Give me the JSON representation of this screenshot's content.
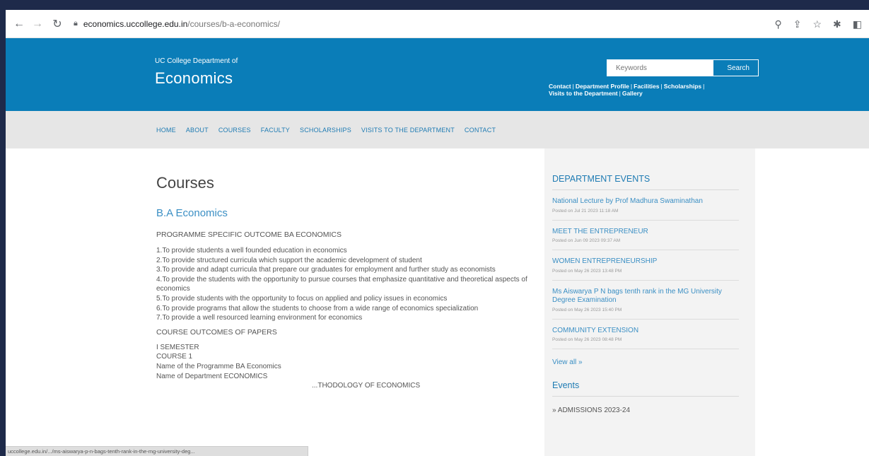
{
  "browser": {
    "url_host": "economics.ucc​ollege.edu.in",
    "url_path": "/courses/b-a-economics/",
    "status_url": "ucc​ollege.edu.in/.../ms-aiswarya-p-n-bags-tenth-rank-in-the-mg-university-deg..."
  },
  "header": {
    "brand_small": "UC College Department of",
    "brand_big": "Economics",
    "search_placeholder": "Keywords",
    "search_button": "Search",
    "quick_links": [
      "Contact",
      "Department Profile",
      "Facilities",
      "Scholarships",
      "Visits to the Department",
      "Gallery"
    ]
  },
  "nav": {
    "items": [
      "HOME",
      "ABOUT",
      "COURSES",
      "FACULTY",
      "SCHOLARSHIPS",
      "VISITS TO THE DEPARTMENT",
      "CONTACT"
    ]
  },
  "main": {
    "page_title": "Courses",
    "course_title": "B.A Economics",
    "programme_heading": "PROGRAMME SPECIFIC OUTCOME BA ECONOMICS",
    "outcomes": [
      "1.To provide students a well founded education in economics",
      "2.To provide structured curricula which support the academic development of student",
      "3.To provide and adapt curricula that prepare our graduates for employment and further study as economists",
      "4.To provide the students with the opportunity to pursue courses that emphasize quantitative and theoretical aspects of economics",
      "5.To provide students with the opportunity to focus on applied and policy issues in economics",
      "6.To provide programs that allow the students to choose from a wide range of economics specialization",
      "7.To provide a well resourced learning environment for economics"
    ],
    "course_outcomes_heading": "COURSE OUTCOMES OF PAPERS",
    "semester": "I SEMESTER",
    "course": "COURSE 1",
    "programme_name": "Name of the Programme BA Economics",
    "department_name": "Name of Department ECONOMICS",
    "hidden_line": "...THODOLOGY OF ECONOMICS"
  },
  "sidebar": {
    "events_title": "DEPARTMENT EVENTS",
    "events": [
      {
        "title": "National Lecture by Prof Madhura Swaminathan",
        "date": "Posted on Jul 21 2023 11:18 AM"
      },
      {
        "title": "MEET THE ENTREPRENEUR",
        "date": "Posted on Jun 09 2023 09:37 AM"
      },
      {
        "title": "WOMEN ENTREPRENEURSHIP",
        "date": "Posted on May 26 2023 13:48 PM"
      },
      {
        "title": "Ms Aiswarya P N bags tenth rank in the MG University Degree Examination",
        "date": "Posted on May 26 2023 15:40 PM"
      },
      {
        "title": "COMMUNITY EXTENSION",
        "date": "Posted on May 26 2023 08:48 PM"
      }
    ],
    "view_all": "View all »",
    "events2_title": "Events",
    "admissions": "» ADMISSIONS 2023-24"
  }
}
